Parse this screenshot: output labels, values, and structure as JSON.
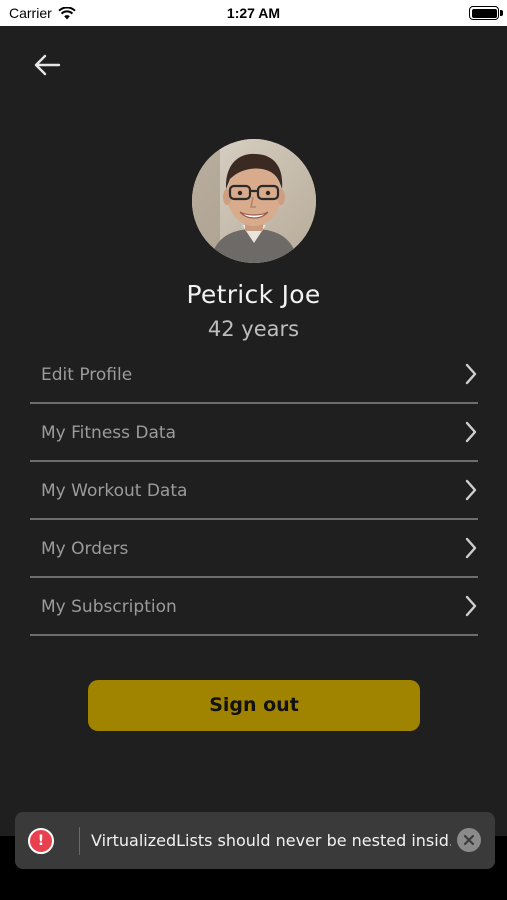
{
  "status_bar": {
    "carrier": "Carrier",
    "time": "1:27 AM"
  },
  "header": {
    "back_icon": "arrow-left-icon"
  },
  "profile": {
    "name": "Petrick Joe",
    "age": "42 years"
  },
  "menu": {
    "items": [
      {
        "label": "Edit Profile"
      },
      {
        "label": "My Fitness Data"
      },
      {
        "label": "My Workout Data"
      },
      {
        "label": "My Orders"
      },
      {
        "label": "My Subscription"
      }
    ]
  },
  "actions": {
    "sign_out": "Sign out"
  },
  "toast": {
    "message": "VirtualizedLists should never be nested insid...",
    "icon": "warning-icon",
    "accent": "#e8404f"
  },
  "colors": {
    "background": "#1f1f1f",
    "accent": "#a08400"
  }
}
